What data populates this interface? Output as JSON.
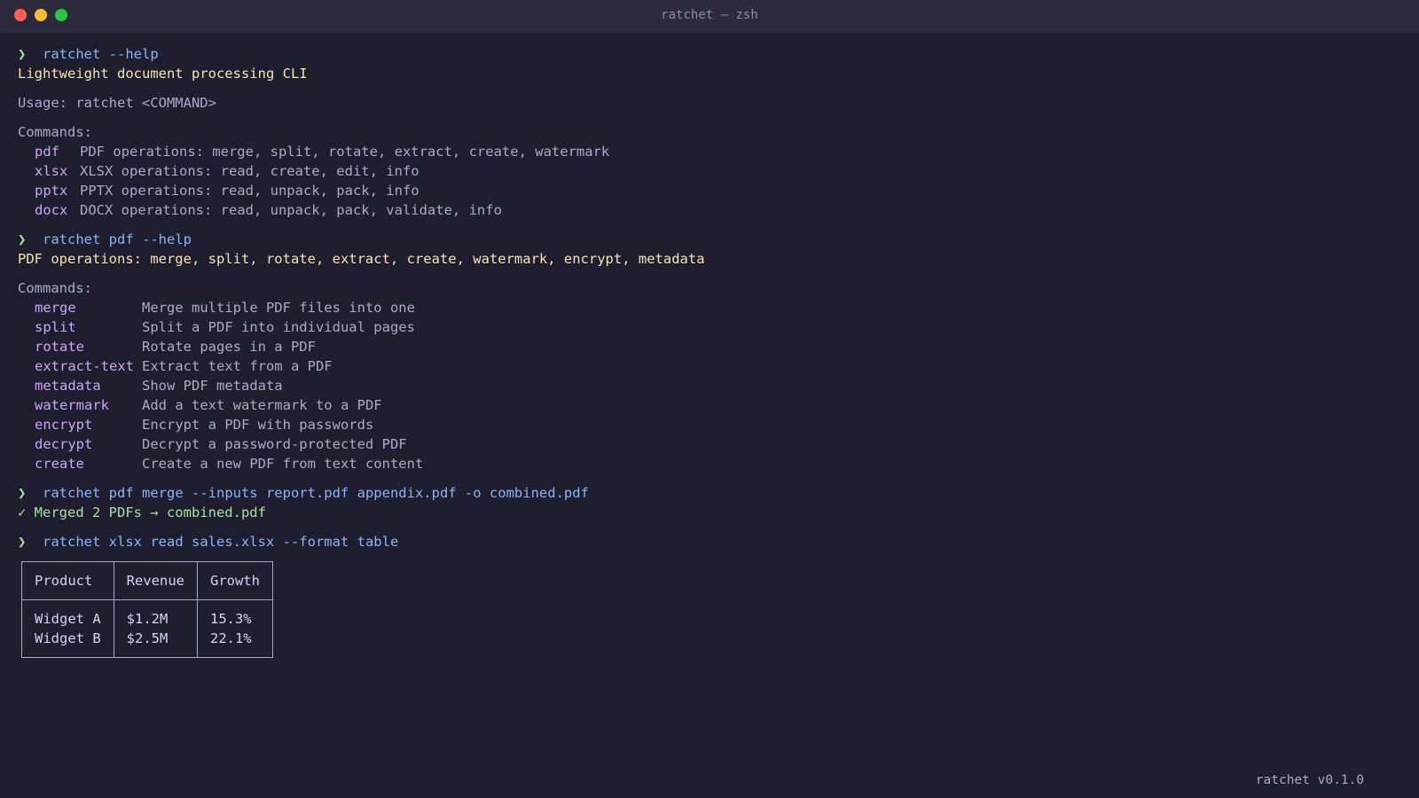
{
  "window": {
    "title": "ratchet — zsh"
  },
  "prompt_symbol": "❯",
  "blocks": {
    "help": {
      "command": "ratchet --help",
      "tagline": "Lightweight document processing CLI",
      "usage": "Usage: ratchet <COMMAND>",
      "commands_header": "Commands:",
      "commands": [
        {
          "name": "pdf",
          "desc": "PDF operations: merge, split, rotate, extract, create, watermark"
        },
        {
          "name": "xlsx",
          "desc": "XLSX operations: read, create, edit, info"
        },
        {
          "name": "pptx",
          "desc": "PPTX operations: read, unpack, pack, info"
        },
        {
          "name": "docx",
          "desc": "DOCX operations: read, unpack, pack, validate, info"
        }
      ]
    },
    "pdf_help": {
      "command": "ratchet pdf --help",
      "tagline": "PDF operations: merge, split, rotate, extract, create, watermark, encrypt, metadata",
      "commands_header": "Commands:",
      "commands": [
        {
          "name": "merge",
          "desc": "Merge multiple PDF files into one"
        },
        {
          "name": "split",
          "desc": "Split a PDF into individual pages"
        },
        {
          "name": "rotate",
          "desc": "Rotate pages in a PDF"
        },
        {
          "name": "extract-text",
          "desc": "Extract text from a PDF"
        },
        {
          "name": "metadata",
          "desc": "Show PDF metadata"
        },
        {
          "name": "watermark",
          "desc": "Add a text watermark to a PDF"
        },
        {
          "name": "encrypt",
          "desc": "Encrypt a PDF with passwords"
        },
        {
          "name": "decrypt",
          "desc": "Decrypt a password-protected PDF"
        },
        {
          "name": "create",
          "desc": "Create a new PDF from text content"
        }
      ]
    },
    "merge": {
      "command": "ratchet pdf merge --inputs report.pdf appendix.pdf -o combined.pdf",
      "result": "✓ Merged 2 PDFs → combined.pdf"
    },
    "xlsx_read": {
      "command": "ratchet xlsx read sales.xlsx --format table",
      "table": {
        "headers": [
          "Product",
          "Revenue",
          "Growth"
        ],
        "rows": [
          [
            "Widget A",
            "$1.2M",
            "15.3%"
          ],
          [
            "Widget B",
            "$2.5M",
            "22.1%"
          ]
        ]
      }
    }
  },
  "status": {
    "version": "ratchet v0.1.0"
  }
}
